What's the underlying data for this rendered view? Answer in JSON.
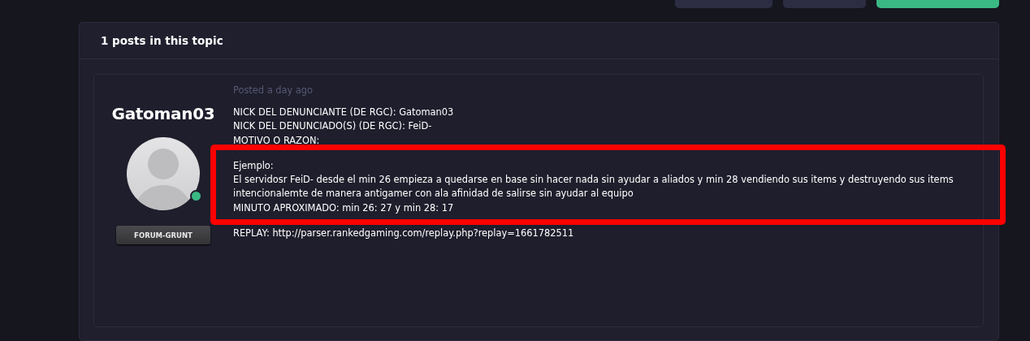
{
  "top_buttons": [
    {
      "kind": "plain"
    },
    {
      "kind": "plain"
    },
    {
      "kind": "primary"
    }
  ],
  "topic": {
    "header": "1 posts in this topic"
  },
  "post": {
    "author": "Gatoman03",
    "online": true,
    "rank": "FORUM-GRUNT",
    "posted": "Posted a day ago",
    "blocks": [
      {
        "highlighted": false,
        "lines": [
          "NICK DEL DENUNCIANTE (DE RGC): Gatoman03",
          "NICK DEL DENUNCIADO(S) (DE RGC): FeiD-",
          "MOTIVO O RAZON:"
        ]
      },
      {
        "highlighted": true,
        "lines": [
          "Ejemplo:",
          "El servidosr FeiD- desde el min 26 empieza a quedarse en base sin hacer nada sin ayudar a aliados y min 28  vendiendo sus items y destruyendo sus items intencionalemte de manera antigamer con ala afinidad de salirse  sin ayudar al equipo",
          "MINUTO APROXIMADO: min 26: 27 y min 28: 17"
        ]
      },
      {
        "highlighted": false,
        "lines": [
          "REPLAY: http://parser.rankedgaming.com/replay.php?replay=1661782511"
        ]
      }
    ]
  }
}
